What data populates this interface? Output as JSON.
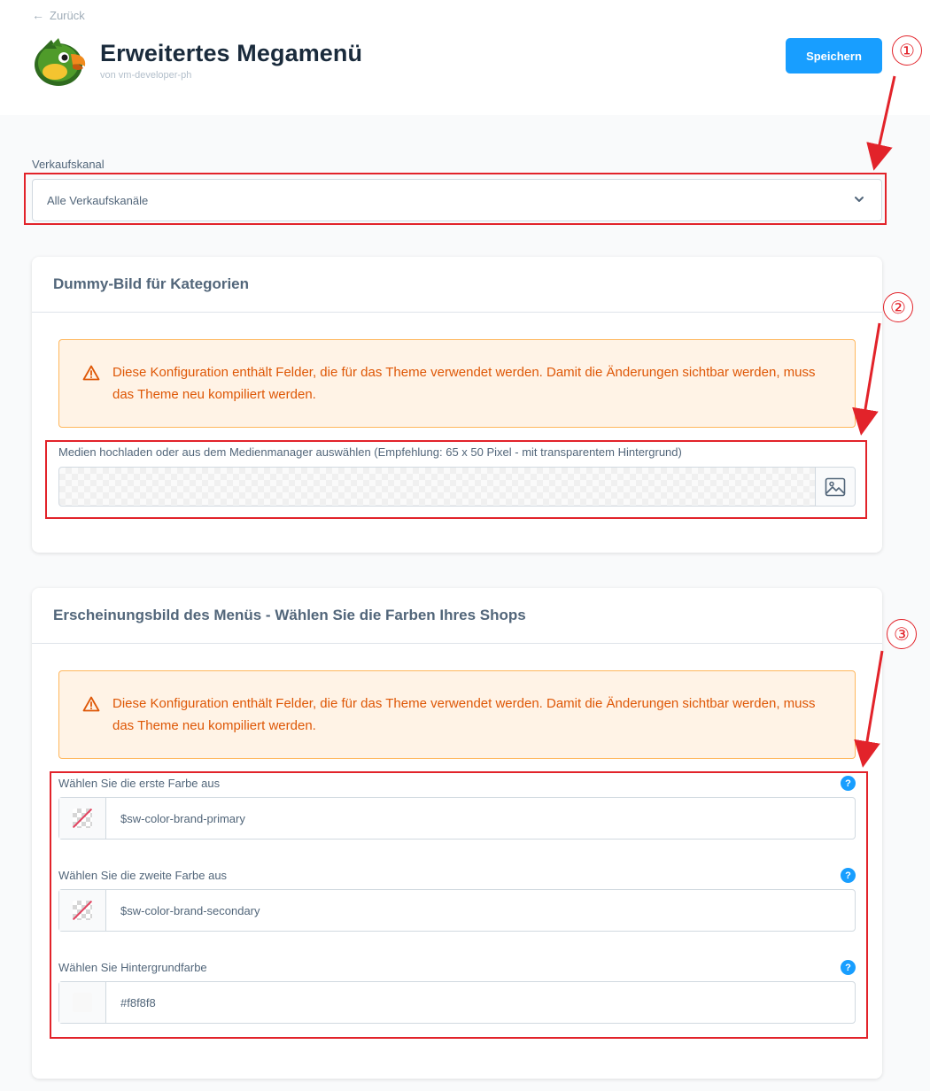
{
  "header": {
    "back_label": "Zurück",
    "app_title": "Erweitertes Megamenü",
    "app_subtitle": "von vm-developer-ph",
    "save_label": "Speichern"
  },
  "sales_channel": {
    "label": "Verkaufskanal",
    "selected": "Alle Verkaufskanäle"
  },
  "card_dummy_image": {
    "title": "Dummy-Bild für Kategorien",
    "warning": "Diese Konfiguration enthält Felder, die für das Theme verwendet werden. Damit die Änderungen sichtbar werden, muss das Theme neu kompiliert werden.",
    "media_label": "Medien hochladen oder aus dem Medienmanager auswählen (Empfehlung: 65 x 50 Pixel - mit transparentem Hintergrund)"
  },
  "card_appearance": {
    "title": "Erscheinungsbild des Menüs - Wählen Sie die Farben Ihres Shops",
    "warning": "Diese Konfiguration enthält Felder, die für das Theme verwendet werden. Damit die Änderungen sichtbar werden, muss das Theme neu kompiliert werden.",
    "fields": [
      {
        "label": "Wählen Sie die erste Farbe aus",
        "value": "$sw-color-brand-primary",
        "swatch": "none"
      },
      {
        "label": "Wählen Sie die zweite Farbe aus",
        "value": "$sw-color-brand-secondary",
        "swatch": "none"
      },
      {
        "label": "Wählen Sie Hintergrundfarbe",
        "value": "#f8f8f8",
        "swatch": "#f8f8f8"
      }
    ],
    "help_symbol": "?"
  },
  "annotations": [
    "①",
    "②",
    "③"
  ],
  "colors": {
    "accent": "#189eff",
    "warning_bg": "#fff3e6",
    "warning_border": "#ffb75d",
    "warning_text": "#de5706",
    "annotation": "#e2232a"
  }
}
